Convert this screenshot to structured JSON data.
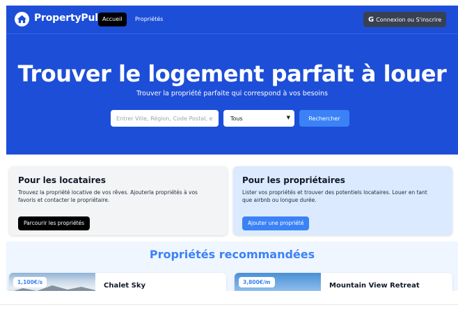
{
  "nav": {
    "brand": "PropertyPulse",
    "links": [
      {
        "label": "Accueil",
        "active": true
      },
      {
        "label": "Propriétés",
        "active": false
      }
    ],
    "login_label": "Connexion ou S'inscrire",
    "login_icon": "google-icon"
  },
  "hero": {
    "title": "Trouver le logement parfait à louer",
    "subtitle": "Trouver la propriété parfaite qui correspond à vos besoins",
    "search_placeholder": "Entrer Ville, Région, Code Postal, etc",
    "type_select_value": "Tous",
    "search_button": "Rechercher"
  },
  "cards": {
    "tenants": {
      "title": "Pour les locataires",
      "text": "Trouvez la propriété locative de vos rêves. Ajouterla propriétés à vos favoris et contacter le propriétaire.",
      "button": "Parcourir les propriétés"
    },
    "owners": {
      "title": "Pour les propriétaires",
      "text": "Lister vos propriétés et trouver des potentiels locataires. Louer en tant que airbnb ou longue durée.",
      "button": "Ajouter une propriété"
    }
  },
  "recommended": {
    "title": "Propriétés recommandées",
    "items": [
      {
        "price": "1,100€/s",
        "name": "Chalet Sky"
      },
      {
        "price": "3,800€/m",
        "name": "Mountain View Retreat"
      }
    ]
  },
  "colors": {
    "brand_blue": "#1d4ed8",
    "accent_blue": "#3b82f6",
    "tenant_card": "#f3f4f6",
    "owner_card": "#dbeafe"
  }
}
